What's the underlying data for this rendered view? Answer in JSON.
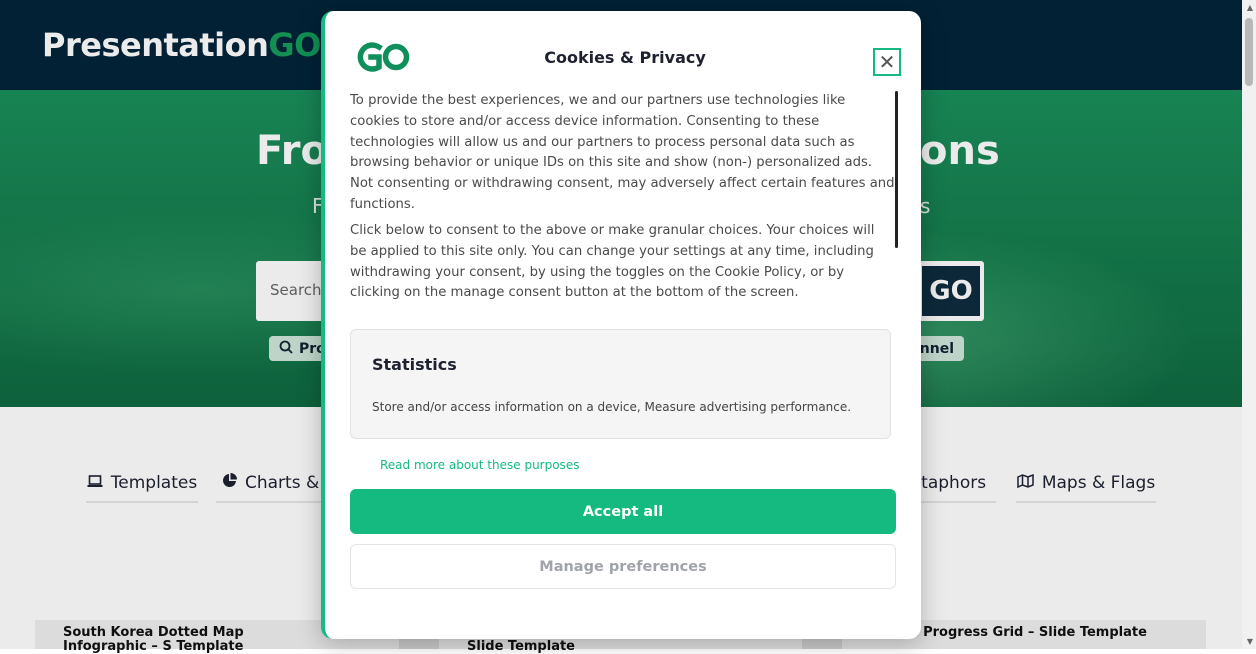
{
  "site": {
    "logo": {
      "main": "Presentation",
      "accent": "GO"
    },
    "hero": {
      "title_left": "Fro",
      "title_right": "ons",
      "sub_left": "F",
      "sub_right": "s"
    },
    "search": {
      "placeholder": "Search .",
      "go_label": "GO"
    },
    "chips": {
      "left": "Pro",
      "right": "nnel"
    },
    "categories": [
      {
        "label": "Templates",
        "icon": "laptop-icon"
      },
      {
        "label": "Charts & [",
        "icon": "pie-chart-icon"
      },
      {
        "label": "letaphors",
        "icon": ""
      },
      {
        "label": "Maps & Flags",
        "icon": "map-icon"
      }
    ],
    "cards": [
      "South Korea Dotted Map Infographic – S Template",
      "Slide Template",
      "nted Progress Grid – Slide Template"
    ]
  },
  "modal": {
    "logo": "GO",
    "title": "Cookies & Privacy",
    "close_label": "✕",
    "paragraph_1": "To provide the best experiences, we and our partners use technologies like cookies to store and/or access device information. Consenting to these technologies will allow us and our partners to process personal data such as browsing behavior or unique IDs on this site and show (non-) personalized ads. Not consenting or withdrawing consent, may adversely affect certain features and functions.",
    "paragraph_2": "Click below to consent to the above or make granular choices. Your choices will be applied to this site only. You can change your settings at any time, including withdrawing your consent, by using the toggles on the Cookie Policy, or by clicking on the manage consent button at the bottom of the screen.",
    "statistics": {
      "title": "Statistics",
      "description": "Store and/or access information on a device, Measure advertising performance."
    },
    "read_more": "Read more about these purposes",
    "accept_all": "Accept all",
    "manage_preferences": "Manage preferences"
  },
  "colors": {
    "header_bg": "#03243a",
    "hero_green": "#147a4c",
    "accent": "#14ba80"
  }
}
